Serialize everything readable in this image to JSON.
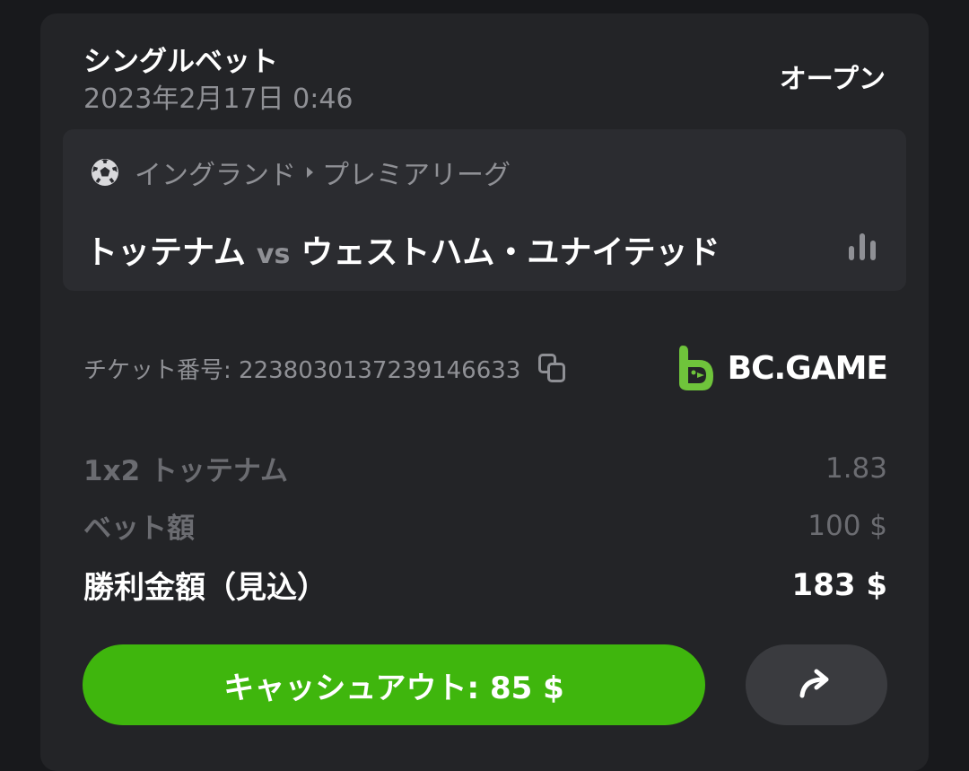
{
  "header": {
    "bet_type": "シングルベット",
    "date": "2023年2月17日 0:46",
    "status": "オープン"
  },
  "match": {
    "league_country": "イングランド",
    "league_name": "プレミアリーグ",
    "home_team": "トッテナム",
    "vs": "vs",
    "away_team": "ウェストハム・ユナイテッド",
    "sport_icon": "soccer-ball-icon",
    "stats_icon": "bar-chart-icon"
  },
  "ticket": {
    "label": "チケット番号: 2238030137239146633",
    "copy_icon": "copy-icon"
  },
  "brand": {
    "name": "BC.GAME",
    "accent": "#6fc43b"
  },
  "details": {
    "market_label": "1x2 トッテナム",
    "odds": "1.83",
    "stake_label": "ベット額",
    "stake_value": "100 $",
    "payout_label": "勝利金額（見込）",
    "payout_value": "183 $"
  },
  "actions": {
    "cashout_label": "キャッシュアウト: 85 $",
    "cashout_color": "#3fb60d",
    "share_icon": "share-arrow-icon"
  }
}
